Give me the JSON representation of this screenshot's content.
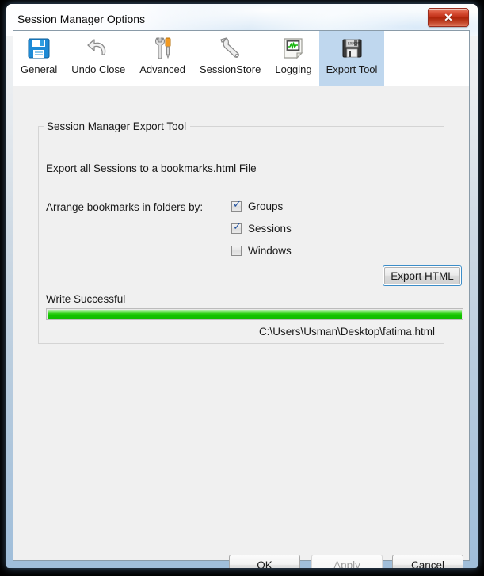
{
  "window": {
    "title": "Session Manager Options",
    "close_label": "✕",
    "close_icon": "close-icon"
  },
  "toolbar": {
    "items": [
      {
        "label": "General",
        "icon": "floppy-disk-blue-icon",
        "selected": false
      },
      {
        "label": "Undo Close",
        "icon": "undo-arrow-icon",
        "selected": false
      },
      {
        "label": "Advanced",
        "icon": "wrench-screwdriver-icon",
        "selected": false
      },
      {
        "label": "SessionStore",
        "icon": "wrench-icon",
        "selected": false
      },
      {
        "label": "Logging",
        "icon": "log-chart-page-icon",
        "selected": false
      },
      {
        "label": "Export Tool",
        "icon": "floppy-disk-export-icon",
        "selected": true
      }
    ]
  },
  "panel": {
    "group_title": "Session Manager Export Tool",
    "description": "Export all Sessions to a bookmarks.html File",
    "arrange_label": "Arrange bookmarks in folders by:",
    "checkboxes": [
      {
        "label": "Groups",
        "checked": true
      },
      {
        "label": "Sessions",
        "checked": true
      },
      {
        "label": "Windows",
        "checked": false
      }
    ],
    "export_button_label": "Export HTML",
    "status_text": "Write Successful",
    "progress_percent": 100,
    "progress_color": "#14c400",
    "file_path": "C:\\Users\\Usman\\Desktop\\fatima.html"
  },
  "footer": {
    "ok_label": "OK",
    "apply_label": "Apply",
    "cancel_label": "Cancel",
    "apply_enabled": false
  }
}
